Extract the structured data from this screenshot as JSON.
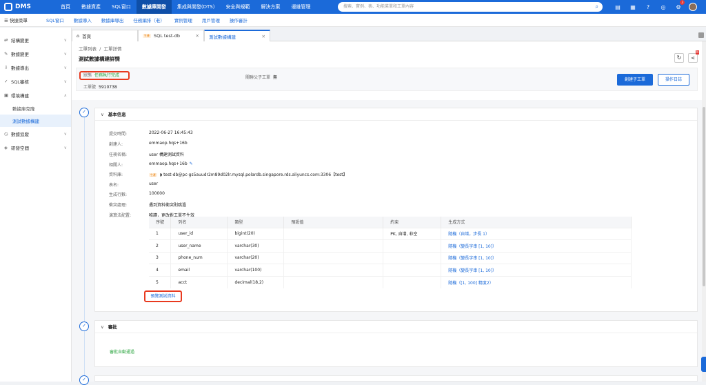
{
  "app": {
    "name": "DMS"
  },
  "topnav": [
    "首頁",
    "數據資產",
    "SQL窗口",
    "數據庫開發",
    "集成與開發(DTS)",
    "安全與規範",
    "解決方案",
    "運維管理"
  ],
  "topnav_active": "數據庫開發",
  "search": {
    "placeholder": "搜索、實例、表、功能菜單和工單內容"
  },
  "notify_badge": "3",
  "subnav": {
    "quick": "快捷菜單",
    "items": [
      "SQL窗口",
      "數據導入",
      "數據庫導出",
      "任務編排（老）",
      "實例管理",
      "用戶管理",
      "操作審計"
    ]
  },
  "sidebar": {
    "items": [
      {
        "label": "結構變更",
        "icon": "⇄"
      },
      {
        "label": "數據變更",
        "icon": "✎"
      },
      {
        "label": "數據導出",
        "icon": "⇩"
      },
      {
        "label": "SQL審核",
        "icon": "✓"
      },
      {
        "label": "環境構建",
        "icon": "▣"
      }
    ],
    "children": [
      "數據庫克隆",
      "測試數據構建"
    ],
    "after": [
      {
        "label": "數據追蹤",
        "icon": "◷"
      },
      {
        "label": "研發空間",
        "icon": "◈"
      }
    ]
  },
  "tabs": [
    {
      "label": "首頁",
      "icon": "⌂"
    },
    {
      "tag": "生產",
      "label": "SQL test-db"
    },
    {
      "label": "測試數據構建"
    }
  ],
  "page": {
    "breadcrumb": [
      "工單列表",
      "工單詳情"
    ],
    "title": "測試數據構建詳情",
    "status_label": "狀態",
    "status_value": "任務執行完成",
    "ticket_label": "工單號",
    "ticket_value": "5910738",
    "related_label": "關聯父子工單",
    "related_value": "無",
    "btn_create": "創建子工單",
    "btn_log": "操作日誌",
    "share_badge": "N"
  },
  "basic": {
    "heading": "基本信息",
    "fields": [
      {
        "k": "提交時間:",
        "v": "2022-06-27 16:45:43"
      },
      {
        "k": "創建人:",
        "v": "emmaop.hqs+16b"
      },
      {
        "k": "任務名稱:",
        "v": "user 構建測試資料"
      },
      {
        "k": "相關人:",
        "v": "emmaop.hqs+16b"
      },
      {
        "k": "資料庫:",
        "v": "test-db@pc-gs5auudr2m89d02lr.mysql.polardb.singapore.rds.aliyuncs.com:3306【test】",
        "tag": "生產"
      },
      {
        "k": "表名:",
        "v": "user"
      },
      {
        "k": "生成行數:",
        "v": "100000"
      },
      {
        "k": "衝突處理:",
        "v": "遇到資料衝突則跳過"
      },
      {
        "k": "演算法配置:",
        "v": "唯讀，更改對工單不生效"
      }
    ],
    "table": {
      "headers": [
        "序號",
        "列名",
        "類型",
        "預設值",
        "約束",
        "生成方式"
      ],
      "rows": [
        [
          "1",
          "user_id",
          "bigint(20)",
          "",
          "PK, 自增, 非空",
          "隨機（自增，步長 1）"
        ],
        [
          "2",
          "user_name",
          "varchar(30)",
          "",
          "",
          "隨機（變長字串 [1, 10]）"
        ],
        [
          "3",
          "phone_num",
          "varchar(20)",
          "",
          "",
          "隨機（變長字串 [1, 10]）"
        ],
        [
          "4",
          "email",
          "varchar(100)",
          "",
          "",
          "隨機（變長字串 [1, 10]）"
        ],
        [
          "5",
          "acct",
          "decimal(18,2)",
          "",
          "",
          "隨機（[1, 100] 精度2）"
        ]
      ]
    },
    "preview_button": "預覽測試資料"
  },
  "approval": {
    "heading": "審批",
    "text": "審批自動通過"
  },
  "colors": {
    "primary": "#1b6ad9",
    "highlight": "#e8391f",
    "success": "#2da641"
  }
}
